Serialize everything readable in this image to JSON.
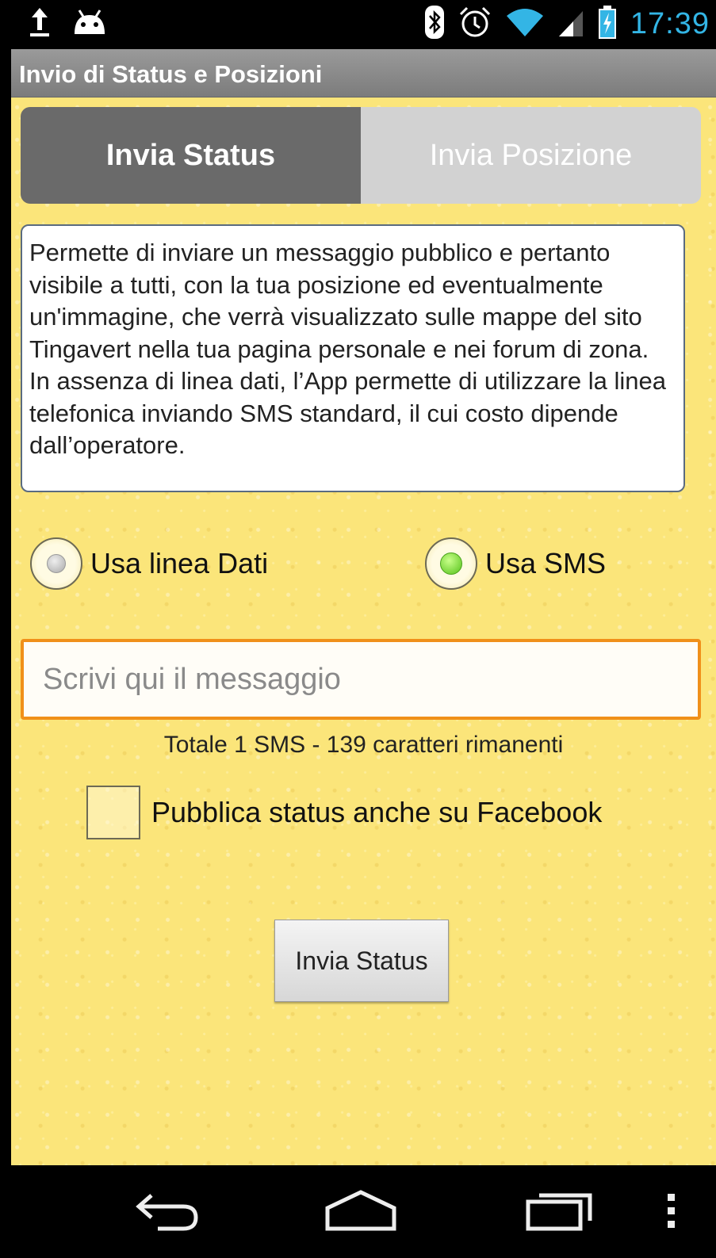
{
  "status_bar": {
    "time": "17:39",
    "icons": [
      "upload-icon",
      "android-icon",
      "bluetooth-icon",
      "alarm-icon",
      "wifi-icon",
      "signal-icon",
      "battery-charging-icon"
    ]
  },
  "action_bar": {
    "title": "Invio di Status e Posizioni"
  },
  "tabs": [
    {
      "label": "Invia Status",
      "active": true
    },
    {
      "label": "Invia Posizione",
      "active": false
    }
  ],
  "info": {
    "paragraph1": "Permette di inviare un messaggio pubblico e pertanto visibile a tutti, con la tua posizione ed eventualmente un'immagine, che verrà visualizzato sulle mappe del sito Tingavert nella tua pagina personale e nei forum di zona.",
    "paragraph2": "In assenza di linea dati, l’App permette di utilizzare la linea telefonica inviando SMS standard, il cui costo dipende dall’operatore."
  },
  "radio": {
    "data_label": "Usa linea Dati",
    "sms_label": "Usa SMS",
    "selected": "sms"
  },
  "message": {
    "placeholder": "Scrivi qui il messaggio",
    "value": ""
  },
  "counter": "Totale 1 SMS - 139 caratteri rimanenti",
  "facebook": {
    "label": "Pubblica status anche su Facebook",
    "checked": false
  },
  "send_button": "Invia Status",
  "nav_bar": {
    "icons": [
      "back-icon",
      "home-icon",
      "recents-icon",
      "menu-icon"
    ]
  },
  "colors": {
    "accent": "#33b5e5",
    "background": "#fbe57a",
    "tab_active": "#6a6a6a",
    "input_border": "#f0901a",
    "radio_selected": "#55c21a"
  }
}
